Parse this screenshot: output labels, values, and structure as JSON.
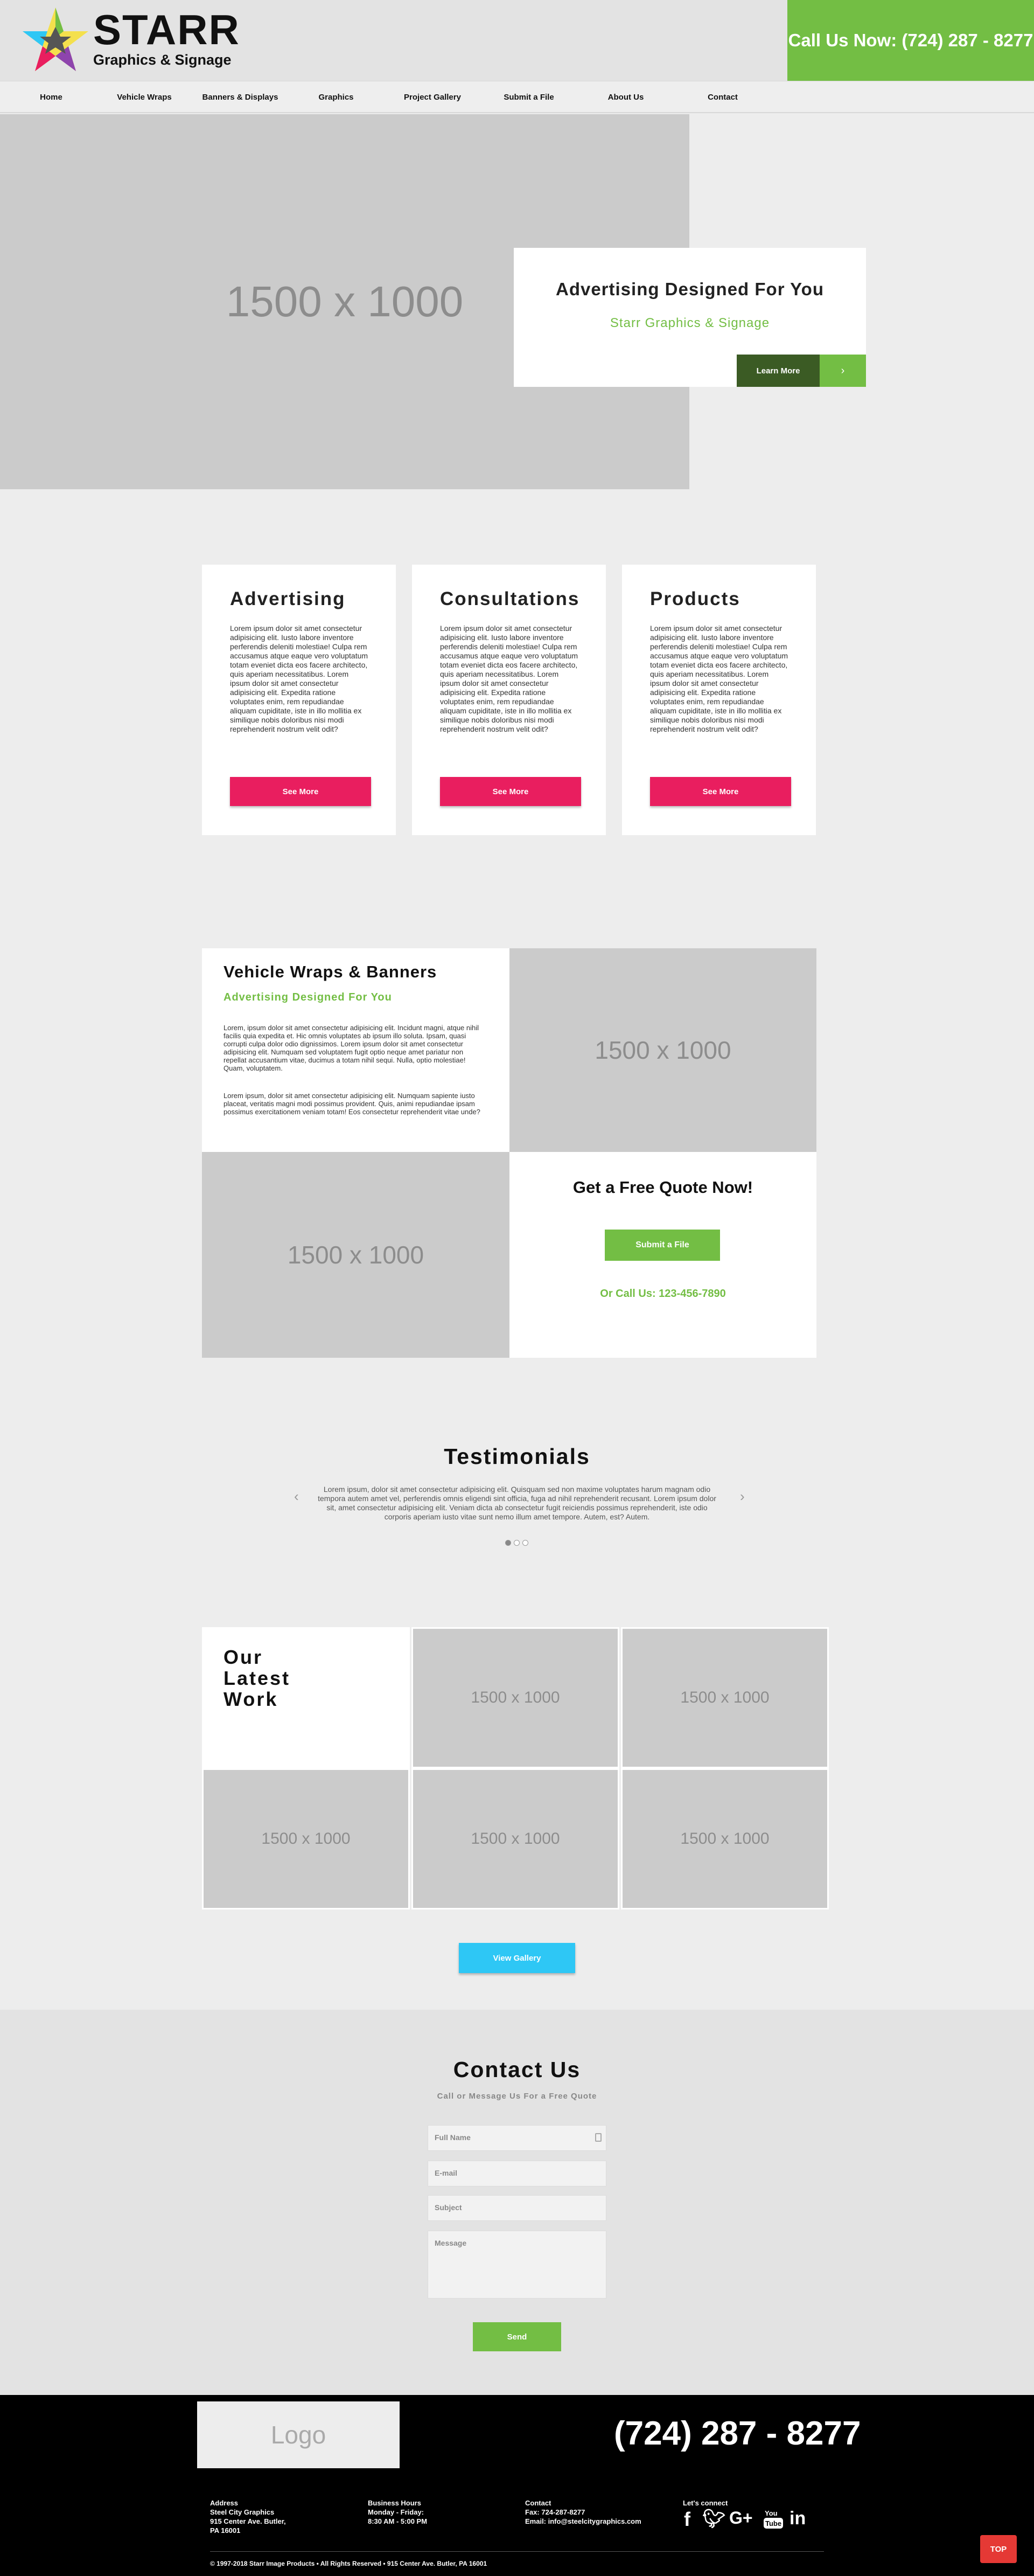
{
  "header": {
    "logo_title": "STARR",
    "logo_subtitle": "Graphics & Signage",
    "call_label": "Call Us Now: (724) 287 - 8277"
  },
  "nav": {
    "items": [
      "Home",
      "Vehicle Wraps",
      "Banners & Displays",
      "Graphics",
      "Project Gallery",
      "Submit a File",
      "About Us",
      "Contact"
    ]
  },
  "hero": {
    "image_placeholder": "1500 x 1000",
    "title": "Advertising Designed For You",
    "subtitle": "Starr Graphics & Signage",
    "button_label": "Learn More",
    "arrow": "›"
  },
  "services": [
    {
      "title": "Advertising",
      "text": "Lorem ipsum dolor sit amet consectetur adipisicing elit. Iusto labore inventore perferendis deleniti molestiae! Culpa rem accusamus atque eaque vero voluptatum totam eveniet dicta eos facere architecto, quis aperiam necessitatibus. Lorem ipsum dolor sit amet consectetur adipisicing elit. Expedita ratione voluptates enim, rem repudiandae aliquam cupiditate, iste in illo mollitia ex similique nobis doloribus nisi modi reprehenderit nostrum velit odit?",
      "button_label": "See More"
    },
    {
      "title": "Consultations",
      "text": "Lorem ipsum dolor sit amet consectetur adipisicing elit. Iusto labore inventore perferendis deleniti molestiae! Culpa rem accusamus atque eaque vero voluptatum totam eveniet dicta eos facere architecto, quis aperiam necessitatibus. Lorem ipsum dolor sit amet consectetur adipisicing elit. Expedita ratione voluptates enim, rem repudiandae aliquam cupiditate, iste in illo mollitia ex similique nobis doloribus nisi modi reprehenderit nostrum velit odit?",
      "button_label": "See More"
    },
    {
      "title": "Products",
      "text": "Lorem ipsum dolor sit amet consectetur adipisicing elit. Iusto labore inventore perferendis deleniti molestiae! Culpa rem accusamus atque eaque vero voluptatum totam eveniet dicta eos facere architecto, quis aperiam necessitatibus. Lorem ipsum dolor sit amet consectetur adipisicing elit. Expedita ratione voluptates enim, rem repudiandae aliquam cupiditate, iste in illo mollitia ex similique nobis doloribus nisi modi reprehenderit nostrum velit odit?",
      "button_label": "See More"
    }
  ],
  "wraps": {
    "title": "Vehicle Wraps & Banners",
    "subtitle": "Advertising Designed For You",
    "paragraph1": "Lorem, ipsum dolor sit amet consectetur adipisicing elit. Incidunt magni, atque nihil facilis quia expedita et. Hic omnis voluptates ab ipsum illo soluta. Ipsam, quasi corrupti culpa dolor odio dignissimos. Lorem ipsum dolor sit amet consectetur adipisicing elit. Numquam sed voluptatem fugit optio neque amet pariatur non repellat accusantium vitae, ducimus a totam nihil sequi. Nulla, optio molestiae! Quam, voluptatem.",
    "paragraph2": "Lorem ipsum, dolor sit amet consectetur adipisicing elit. Numquam sapiente iusto placeat, veritatis magni modi possimus provident. Quis, animi repudiandae ipsam possimus exercitationem veniam totam! Eos consectetur reprehenderit vitae unde?",
    "image_placeholder_1": "1500 x 1000",
    "image_placeholder_2": "1500 x 1000",
    "quote_title": "Get a Free Quote Now!",
    "quote_button": "Submit a File",
    "quote_call": "Or Call Us: 123-456-7890"
  },
  "testimonials": {
    "title": "Testimonials",
    "text": "Lorem ipsum, dolor sit amet consectetur adipisicing elit. Quisquam sed non maxime voluptates harum magnam odio tempora autem amet vel, perferendis omnis eligendi sint officia, fuga ad nihil reprehenderit recusant. Lorem ipsum dolor sit, amet consectetur adipisicing elit. Veniam dicta ab consectetur fugit reiciendis possimus reprehenderit, iste odio corporis aperiam iusto vitae sunt nemo illum amet tempore. Autem, est? Autem.",
    "prev_arrow": "‹",
    "next_arrow": "›"
  },
  "gallery": {
    "title": "Our Latest Work",
    "placeholders": [
      "1500 x 1000",
      "1500 x 1000",
      "1500 x 1000",
      "1500 x 1000",
      "1500 x 1000"
    ],
    "button_label": "View Gallery"
  },
  "contact": {
    "title": "Contact Us",
    "subtitle": "Call or Message Us For a Free Quote",
    "fields": {
      "name_placeholder": "Full Name",
      "email_placeholder": "E-mail",
      "subject_placeholder": "Subject",
      "message_placeholder": "Message"
    },
    "send_label": "Send"
  },
  "footer": {
    "logo_placeholder": "Logo",
    "phone": "(724) 287 - 8277",
    "address": {
      "heading": "Address",
      "line1": "Steel City Graphics",
      "line2": "915 Center Ave. Butler,",
      "line3": "PA 16001"
    },
    "hours": {
      "heading": "Business Hours",
      "line1": "Monday - Friday:",
      "line2": "8:30 AM - 5:00 PM"
    },
    "contact": {
      "heading": "Contact",
      "line1": "Fax: 724-287-8277",
      "line2": "Email: info@steelcitygraphics.com"
    },
    "social": {
      "heading": "Let's connect",
      "icons": [
        "facebook-icon",
        "twitter-icon",
        "google-plus-icon",
        "youtube-icon",
        "linkedin-icon"
      ]
    },
    "copyright": "© 1997-2018 Starr Image Products • All Rights Reserved • 915 Center Ave. Butler, PA 16001",
    "top_label": "TOP"
  },
  "colors": {
    "green": "#73be44",
    "dark_green": "#3b5b24",
    "pink": "#e91e5f",
    "cyan": "#2ec7f5",
    "red": "#e53935"
  }
}
